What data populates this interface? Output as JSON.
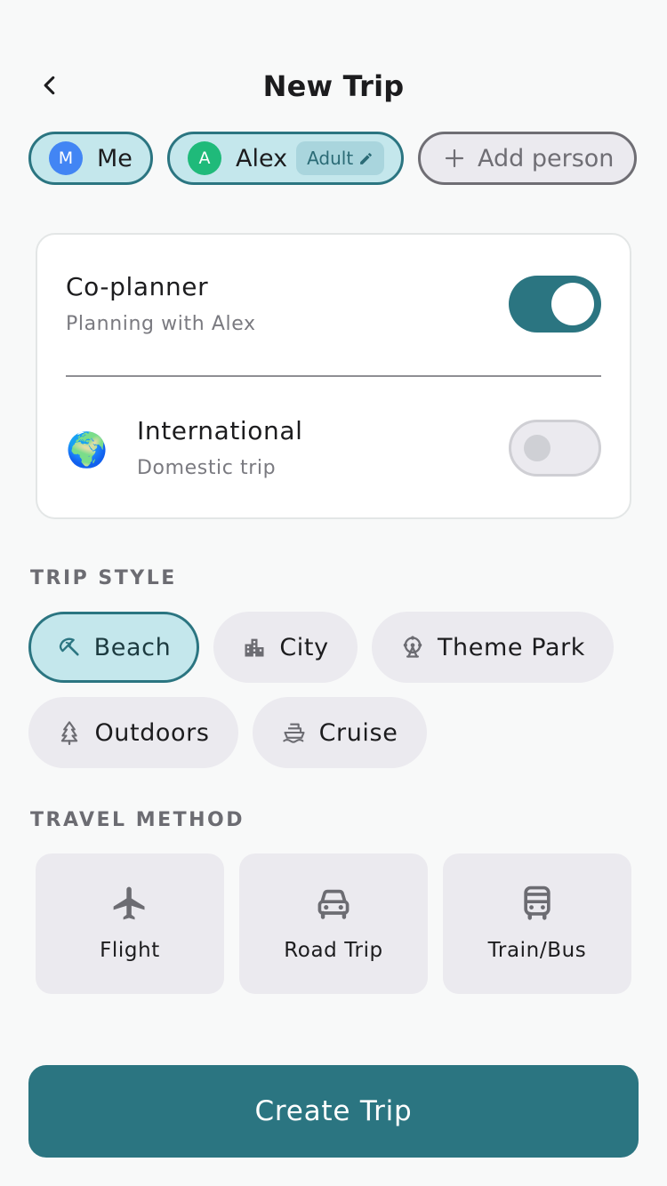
{
  "header": {
    "title": "New Trip"
  },
  "people": [
    {
      "initial": "M",
      "name": "Me",
      "avatar_color": "#4285f4"
    },
    {
      "initial": "A",
      "name": "Alex",
      "role": "Adult",
      "avatar_color": "#1fba7a"
    }
  ],
  "add_person_label": "Add person",
  "settings": {
    "coplanner": {
      "title": "Co-planner",
      "subtitle": "Planning with Alex",
      "enabled": true
    },
    "international": {
      "icon": "🌍",
      "title": "International",
      "subtitle": "Domestic trip",
      "enabled": false
    }
  },
  "trip_style": {
    "label": "TRIP STYLE",
    "options": [
      {
        "label": "Beach",
        "icon": "umbrella-icon",
        "selected": true
      },
      {
        "label": "City",
        "icon": "building-icon",
        "selected": false
      },
      {
        "label": "Theme Park",
        "icon": "ferris-wheel-icon",
        "selected": false
      },
      {
        "label": "Outdoors",
        "icon": "pine-tree-icon",
        "selected": false
      },
      {
        "label": "Cruise",
        "icon": "ship-icon",
        "selected": false
      }
    ]
  },
  "travel_method": {
    "label": "TRAVEL METHOD",
    "options": [
      {
        "label": "Flight",
        "icon": "airplane-icon"
      },
      {
        "label": "Road Trip",
        "icon": "car-icon"
      },
      {
        "label": "Train/Bus",
        "icon": "bus-icon"
      }
    ]
  },
  "create_button": "Create Trip",
  "colors": {
    "accent": "#2b7581",
    "accent_light": "#c4e7ec",
    "chip_bg": "#ebeaef"
  }
}
